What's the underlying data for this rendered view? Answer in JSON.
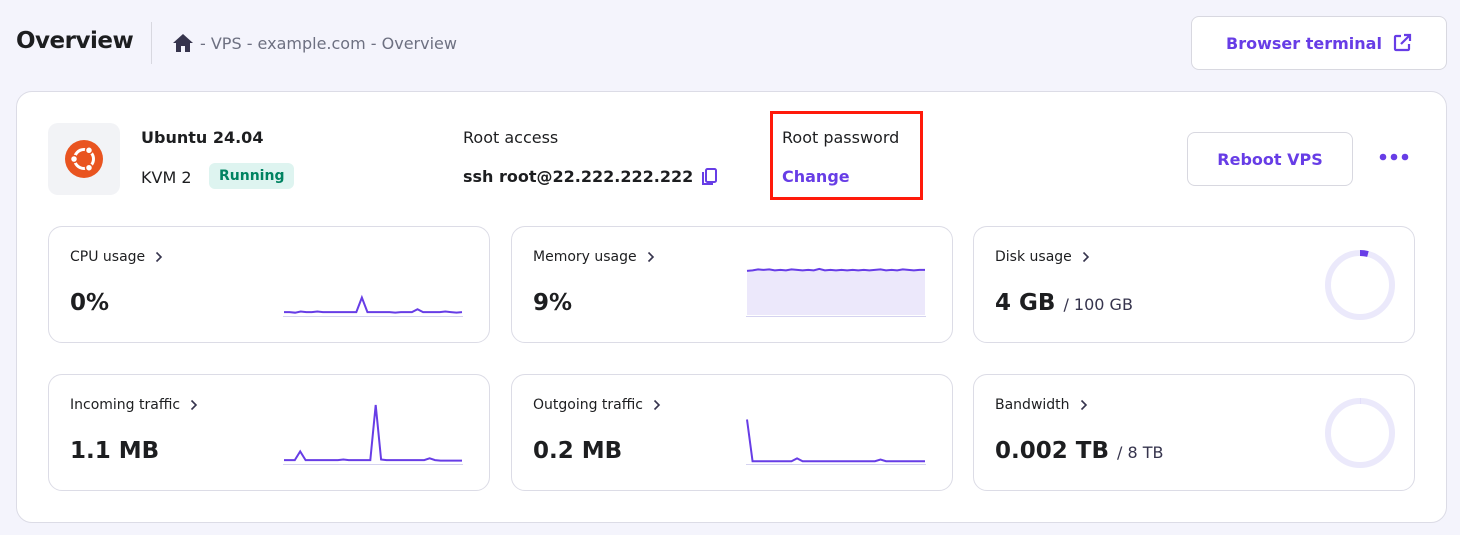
{
  "header": {
    "title": "Overview",
    "breadcrumb": "- VPS - example.com - Overview",
    "terminal_button": "Browser terminal"
  },
  "server": {
    "os": "Ubuntu 24.04",
    "plan": "KVM 2",
    "status": "Running",
    "root_access_label": "Root access",
    "ssh": "ssh root@22.222.222.222",
    "root_password_label": "Root password",
    "change_link": "Change",
    "reboot_button": "Reboot VPS"
  },
  "colors": {
    "accent": "#673de6",
    "status": "#008361",
    "highlight": "#ff1a0a"
  },
  "metrics": [
    {
      "label": "CPU usage",
      "value": "0%",
      "sub": "",
      "series": [
        0.05,
        0.05,
        0.04,
        0.06,
        0.05,
        0.05,
        0.06,
        0.05,
        0.05,
        0.05,
        0.05,
        0.05,
        0.05,
        0.05,
        0.3,
        0.05,
        0.05,
        0.05,
        0.05,
        0.05,
        0.04,
        0.05,
        0.05,
        0.05,
        0.1,
        0.05,
        0.05,
        0.05,
        0.05,
        0.06,
        0.05,
        0.04,
        0.05
      ]
    },
    {
      "label": "Memory usage",
      "value": "9%",
      "sub": "",
      "series": [
        0.92,
        0.93,
        0.95,
        0.94,
        0.95,
        0.93,
        0.94,
        0.93,
        0.95,
        0.94,
        0.93,
        0.94,
        0.93,
        0.96,
        0.93,
        0.94,
        0.93,
        0.94,
        0.93,
        0.94,
        0.93,
        0.94,
        0.93,
        0.94,
        0.95,
        0.93,
        0.94,
        0.93,
        0.95,
        0.94,
        0.93,
        0.94,
        0.94
      ],
      "fill": true
    },
    {
      "label": "Disk usage",
      "value": "4 GB",
      "sub": "/ 100 GB",
      "fraction": 0.04
    },
    {
      "label": "Incoming traffic",
      "value": "1.1 MB",
      "sub": "",
      "series": [
        0.05,
        0.05,
        0.05,
        0.2,
        0.05,
        0.05,
        0.05,
        0.05,
        0.05,
        0.05,
        0.05,
        0.06,
        0.05,
        0.05,
        0.05,
        0.05,
        0.05,
        1,
        0.06,
        0.05,
        0.05,
        0.05,
        0.05,
        0.05,
        0.05,
        0.05,
        0.05,
        0.08,
        0.05,
        0.04,
        0.04,
        0.04,
        0.04,
        0.04
      ]
    },
    {
      "label": "Outgoing traffic",
      "value": "0.2 MB",
      "sub": "",
      "series": [
        0.75,
        0.03,
        0.03,
        0.03,
        0.03,
        0.03,
        0.03,
        0.03,
        0.03,
        0.08,
        0.03,
        0.03,
        0.03,
        0.03,
        0.03,
        0.03,
        0.03,
        0.03,
        0.03,
        0.03,
        0.03,
        0.03,
        0.03,
        0.03,
        0.06,
        0.03,
        0.03,
        0.03,
        0.03,
        0.03,
        0.03,
        0.03,
        0.03
      ]
    },
    {
      "label": "Bandwidth",
      "value": "0.002 TB",
      "sub": "/ 8 TB",
      "fraction": 0.0003
    }
  ]
}
